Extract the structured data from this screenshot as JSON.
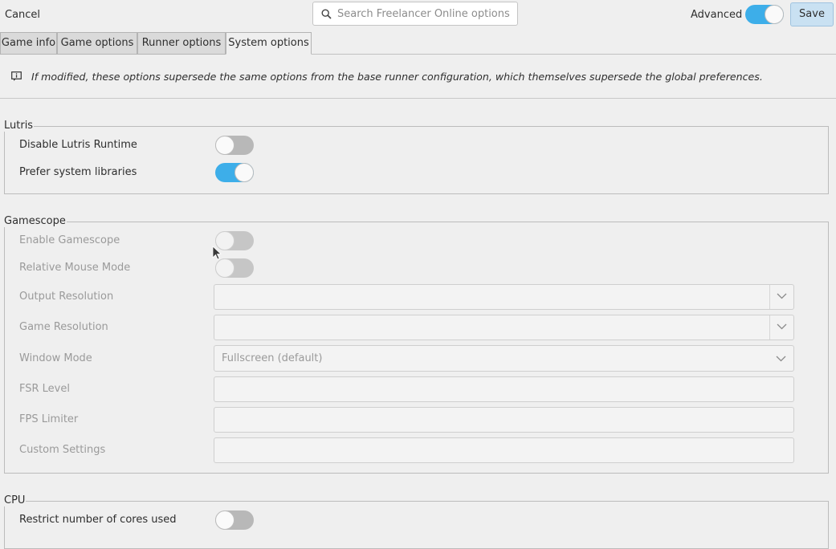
{
  "header": {
    "cancel_label": "Cancel",
    "search_placeholder": "Search Freelancer Online options",
    "search_value": "",
    "advanced_label": "Advanced",
    "advanced_on": true,
    "save_label": "Save"
  },
  "tabs": [
    {
      "label": "Game info",
      "active": false
    },
    {
      "label": "Game options",
      "active": false
    },
    {
      "label": "Runner options",
      "active": false
    },
    {
      "label": "System options",
      "active": true
    }
  ],
  "info_text": "If modified, these options supersede the same options from the base runner configuration, which themselves supersede the global preferences.",
  "sections": {
    "lutris": {
      "title": "Lutris",
      "disable_runtime": {
        "label": "Disable Lutris Runtime",
        "on": false
      },
      "prefer_system_libs": {
        "label": "Prefer system libraries",
        "on": true
      }
    },
    "gamescope": {
      "title": "Gamescope",
      "enable": {
        "label": "Enable Gamescope",
        "on": false
      },
      "relative_mouse": {
        "label": "Relative Mouse Mode",
        "on": false
      },
      "output_resolution": {
        "label": "Output Resolution",
        "value": ""
      },
      "game_resolution": {
        "label": "Game Resolution",
        "value": ""
      },
      "window_mode": {
        "label": "Window Mode",
        "value": "Fullscreen (default)"
      },
      "fsr_level": {
        "label": "FSR Level",
        "value": ""
      },
      "fps_limiter": {
        "label": "FPS Limiter",
        "value": ""
      },
      "custom_settings": {
        "label": "Custom Settings",
        "value": ""
      }
    },
    "cpu": {
      "title": "CPU",
      "restrict_cores": {
        "label": "Restrict number of cores used",
        "on": false
      }
    }
  },
  "colors": {
    "accent": "#3daee9",
    "background": "#efefef",
    "save_button": "#c9e1f2"
  }
}
